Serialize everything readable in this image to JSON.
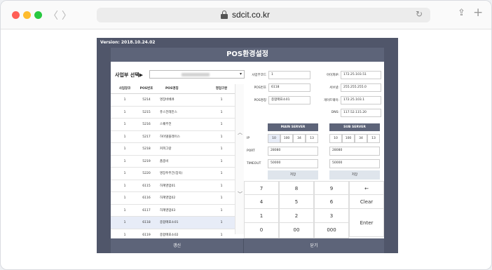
{
  "browser": {
    "url": "sdcit.co.kr",
    "back_icon": "chevron-left-icon",
    "forward_icon": "chevron-right-icon",
    "back_glyph": "〈",
    "forward_glyph": "〉",
    "reload_glyph": "↻",
    "share_glyph": "⇪",
    "newtab_glyph": "+"
  },
  "app": {
    "version": "Version: 2018.10.24.02",
    "title": "POS환경설정",
    "business_label": "사업부 선택▶",
    "business_arrow": "▾",
    "scroll_up": "︿",
    "scroll_down": "﹀"
  },
  "list": {
    "headers": [
      "사업장코드",
      "POS번호",
      "POS명칭",
      "영업구분"
    ],
    "rows": [
      {
        "code": "1",
        "pos_no": "5214",
        "name": "명장바베큐",
        "type": "1",
        "selected": false
      },
      {
        "code": "1",
        "pos_no": "5215",
        "name": "퓨스전레진스",
        "type": "1",
        "selected": false
      },
      {
        "code": "1",
        "pos_no": "5216",
        "name": "스퀘주전",
        "type": "1",
        "selected": false
      },
      {
        "code": "1",
        "pos_no": "5217",
        "name": "하이델플래이스",
        "type": "1",
        "selected": false
      },
      {
        "code": "1",
        "pos_no": "5218",
        "name": "커피그랑",
        "type": "1",
        "selected": false
      },
      {
        "code": "1",
        "pos_no": "5219",
        "name": "품종비",
        "type": "1",
        "selected": false
      },
      {
        "code": "1",
        "pos_no": "5220",
        "name": "명장푸주간(장욱)",
        "type": "1",
        "selected": false
      },
      {
        "code": "1",
        "pos_no": "6115",
        "name": "하계영업01",
        "type": "1",
        "selected": false
      },
      {
        "code": "1",
        "pos_no": "6116",
        "name": "하계영업02",
        "type": "1",
        "selected": false
      },
      {
        "code": "1",
        "pos_no": "6117",
        "name": "하계영업03",
        "type": "1",
        "selected": false
      },
      {
        "code": "1",
        "pos_no": "6118",
        "name": "종합매표소01",
        "type": "1",
        "selected": true
      },
      {
        "code": "1",
        "pos_no": "6119",
        "name": "종합매표소02",
        "type": "1",
        "selected": false
      }
    ]
  },
  "form": {
    "biz_code_label": "사업부코드",
    "biz_code": "1",
    "pos_no_label": "POS번호",
    "pos_no": "6118",
    "pos_name_label": "POS명칭",
    "pos_name": "종합매표소01",
    "my_ip_label": "아이피IP:",
    "my_ip": "172.25.103.51",
    "subnet_label": "서브넷:",
    "subnet": "255.255.255.0",
    "gateway_label": "게이트웨이:",
    "gateway": "172.25.103.1",
    "dns_label": "DNS:",
    "dns": "117.52.115.20"
  },
  "servers": {
    "ip_label": "IP",
    "port_label": "PORT",
    "timeout_label": "TIMEOUT",
    "main": {
      "title": "MAIN SERVER",
      "ip": [
        "10",
        "100",
        "34",
        "13"
      ],
      "port": "28080",
      "timeout": "50000",
      "save": "저장"
    },
    "sub": {
      "title": "SUB SERVER",
      "ip": [
        "10",
        "100",
        "34",
        "13"
      ],
      "port": "28080",
      "timeout": "50000",
      "save": "저장"
    }
  },
  "keypad": {
    "keys": [
      "7",
      "8",
      "9",
      "←",
      "4",
      "5",
      "6",
      "Clear",
      "1",
      "2",
      "3",
      "Enter",
      "0",
      "00",
      "000"
    ]
  },
  "bottom": {
    "refresh": "갱신",
    "close": "닫기"
  }
}
